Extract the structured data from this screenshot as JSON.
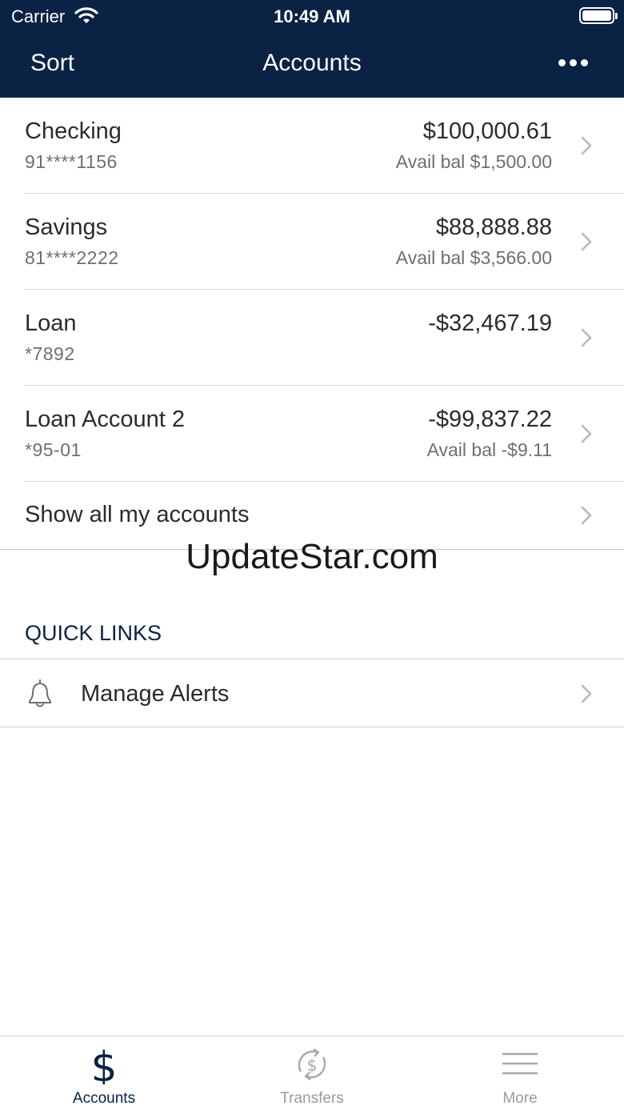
{
  "status_bar": {
    "carrier": "Carrier",
    "time": "10:49 AM"
  },
  "nav": {
    "sort_label": "Sort",
    "title": "Accounts"
  },
  "accounts": [
    {
      "name": "Checking",
      "number": "91****1156",
      "balance": "$100,000.61",
      "available": "Avail bal $1,500.00"
    },
    {
      "name": "Savings",
      "number": "81****2222",
      "balance": "$88,888.88",
      "available": "Avail bal $3,566.00"
    },
    {
      "name": "Loan",
      "number": "*7892",
      "balance": "-$32,467.19",
      "available": ""
    },
    {
      "name": "Loan Account 2",
      "number": "*95-01",
      "balance": "-$99,837.22",
      "available": "Avail bal -$9.11"
    }
  ],
  "show_all_label": "Show all my accounts",
  "watermark": "UpdateStar.com",
  "quick_links": {
    "header": "QUICK LINKS",
    "items": [
      {
        "label": "Manage Alerts",
        "icon": "bell-icon"
      }
    ]
  },
  "tabs": [
    {
      "label": "Accounts",
      "icon": "dollar-icon",
      "active": true
    },
    {
      "label": "Transfers",
      "icon": "transfer-icon",
      "active": false
    },
    {
      "label": "More",
      "icon": "menu-icon",
      "active": false
    }
  ],
  "colors": {
    "header_bg": "#0a2244",
    "accent": "#0a2244",
    "inactive": "#9a9a9a"
  }
}
